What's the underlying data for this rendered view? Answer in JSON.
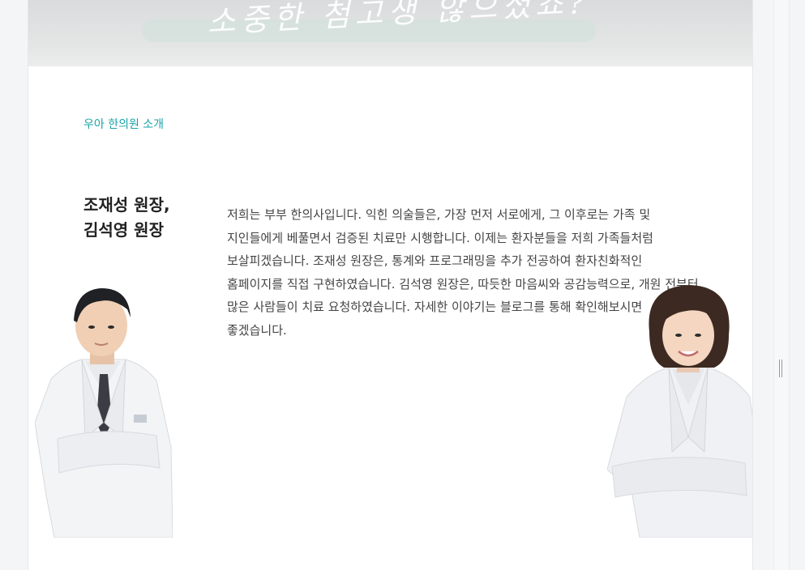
{
  "hero": {
    "caption": "소중한 첨고생 않으셨죠?",
    "colors": {
      "overlay": "#e4e6e6",
      "stroke": "#cfe1db"
    }
  },
  "section": {
    "label": "우아 한의원 소개",
    "label_color": "#1aa3a6"
  },
  "title": {
    "line1": "조재성 원장,",
    "line2": "김석영 원장"
  },
  "intro": {
    "text": "저희는 부부 한의사입니다. 익힌 의술들은, 가장 먼저 서로에게, 그 이후로는 가족 및 지인들에게 베풀면서 검증된 치료만 시행합니다. 이제는 환자분들을 저희 가족들처럼 보살피겠습니다. 조재성 원장은, 통계와 프로그래밍을 추가 전공하여 환자친화적인 홈페이지를 직접 구현하였습니다. 김석영 원장은, 따듯한 마음씨와 공감능력으로, 개원 전부터 많은 사람들이 치료 요청하였습니다. 자세한 이야기는 블로그를 통해 확인해보시면 좋겠습니다."
  },
  "doctors": [
    {
      "name": "조재성 원장",
      "icon": "doctor-portrait-male"
    },
    {
      "name": "김석영 원장",
      "icon": "doctor-portrait-female"
    }
  ],
  "colors": {
    "page_bg": "#f4f5f6",
    "card_bg": "#ffffff",
    "text": "#444444",
    "title": "#222222"
  }
}
